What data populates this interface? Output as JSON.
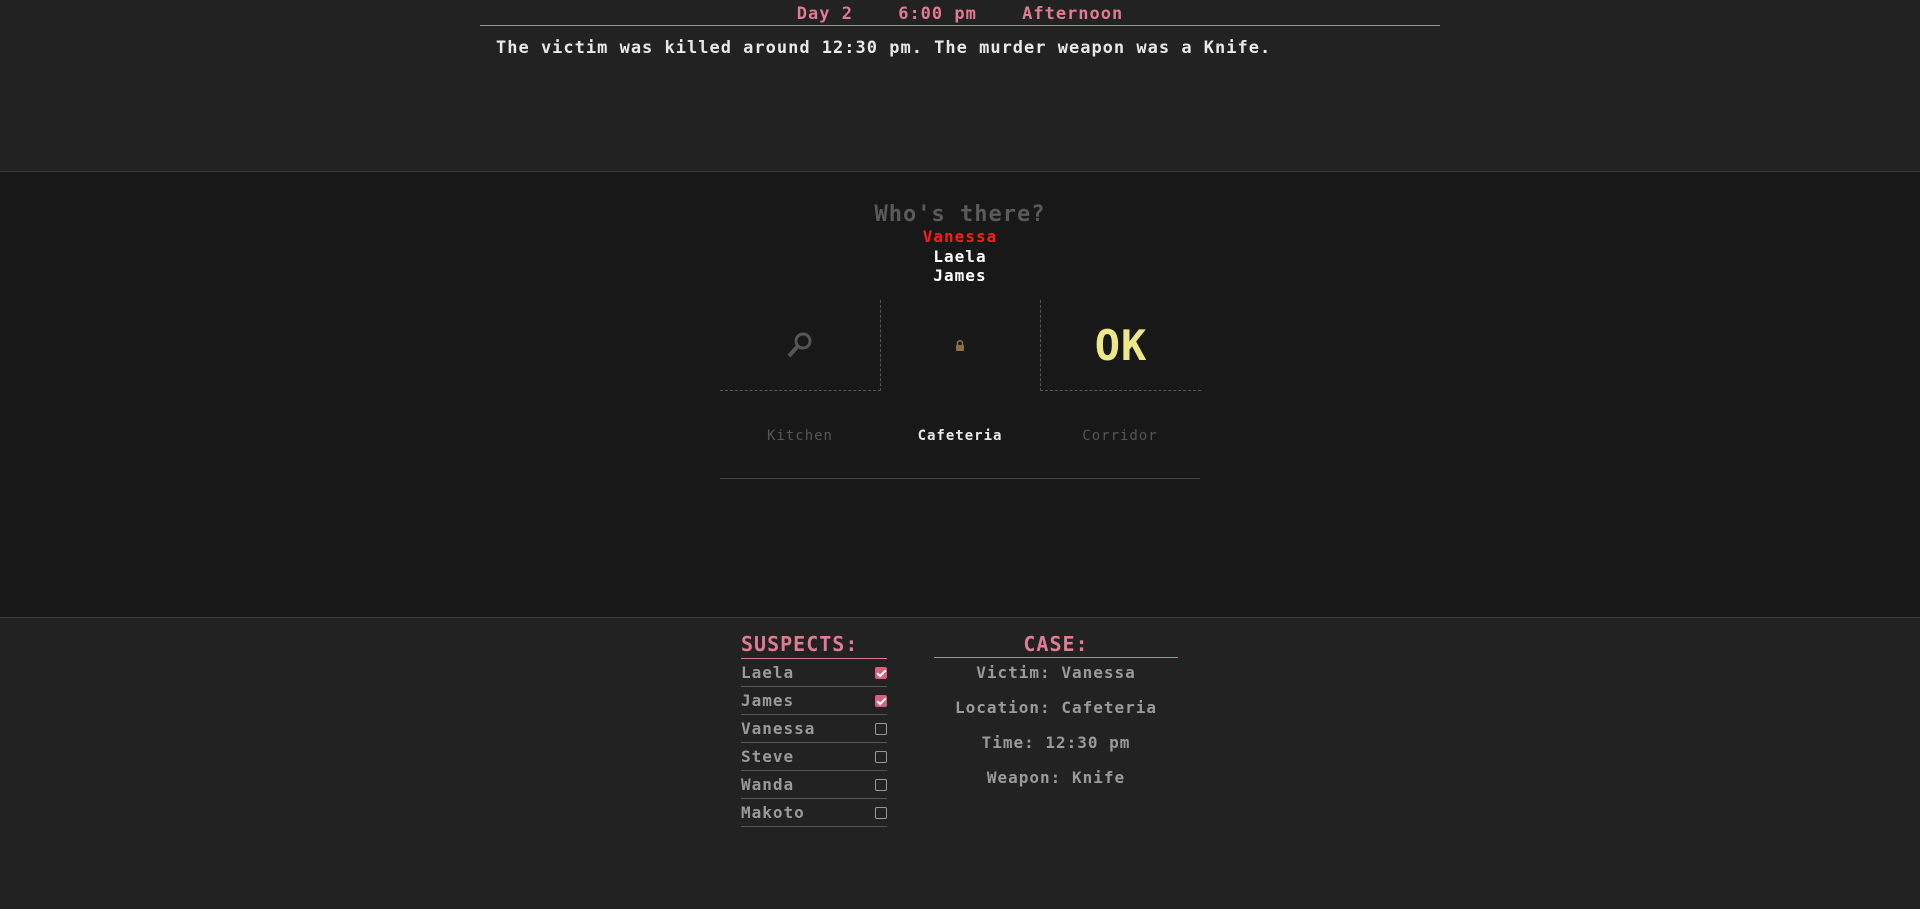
{
  "hud": {
    "day": "Day 2",
    "time": "6:00 pm",
    "period": "Afternoon"
  },
  "message": "The victim was killed around 12:30 pm. The murder weapon was a Knife.",
  "scene": {
    "title": "Who's there?",
    "people": [
      "Vanessa",
      "Laela",
      "James"
    ],
    "victim": "Vanessa"
  },
  "rooms": {
    "left": {
      "label": "Kitchen",
      "icon": "magnifier-icon"
    },
    "center": {
      "label": "Cafeteria",
      "icon": "lock-icon"
    },
    "right": {
      "label": "Corridor",
      "action_label": "OK"
    }
  },
  "suspects": {
    "title": "SUSPECTS:",
    "items": [
      {
        "name": "Laela",
        "checked": true
      },
      {
        "name": "James",
        "checked": true
      },
      {
        "name": "Vanessa",
        "checked": false
      },
      {
        "name": "Steve",
        "checked": false
      },
      {
        "name": "Wanda",
        "checked": false
      },
      {
        "name": "Makoto",
        "checked": false
      }
    ]
  },
  "case": {
    "title": "CASE:",
    "victim": "Victim: Vanessa",
    "location": "Location: Cafeteria",
    "time": "Time: 12:30 pm",
    "weapon": "Weapon: Knife"
  },
  "colors": {
    "accent": "#e07b93",
    "victim": "#ff1a1a",
    "ok": "#ece88a",
    "check": "#d9607a"
  }
}
